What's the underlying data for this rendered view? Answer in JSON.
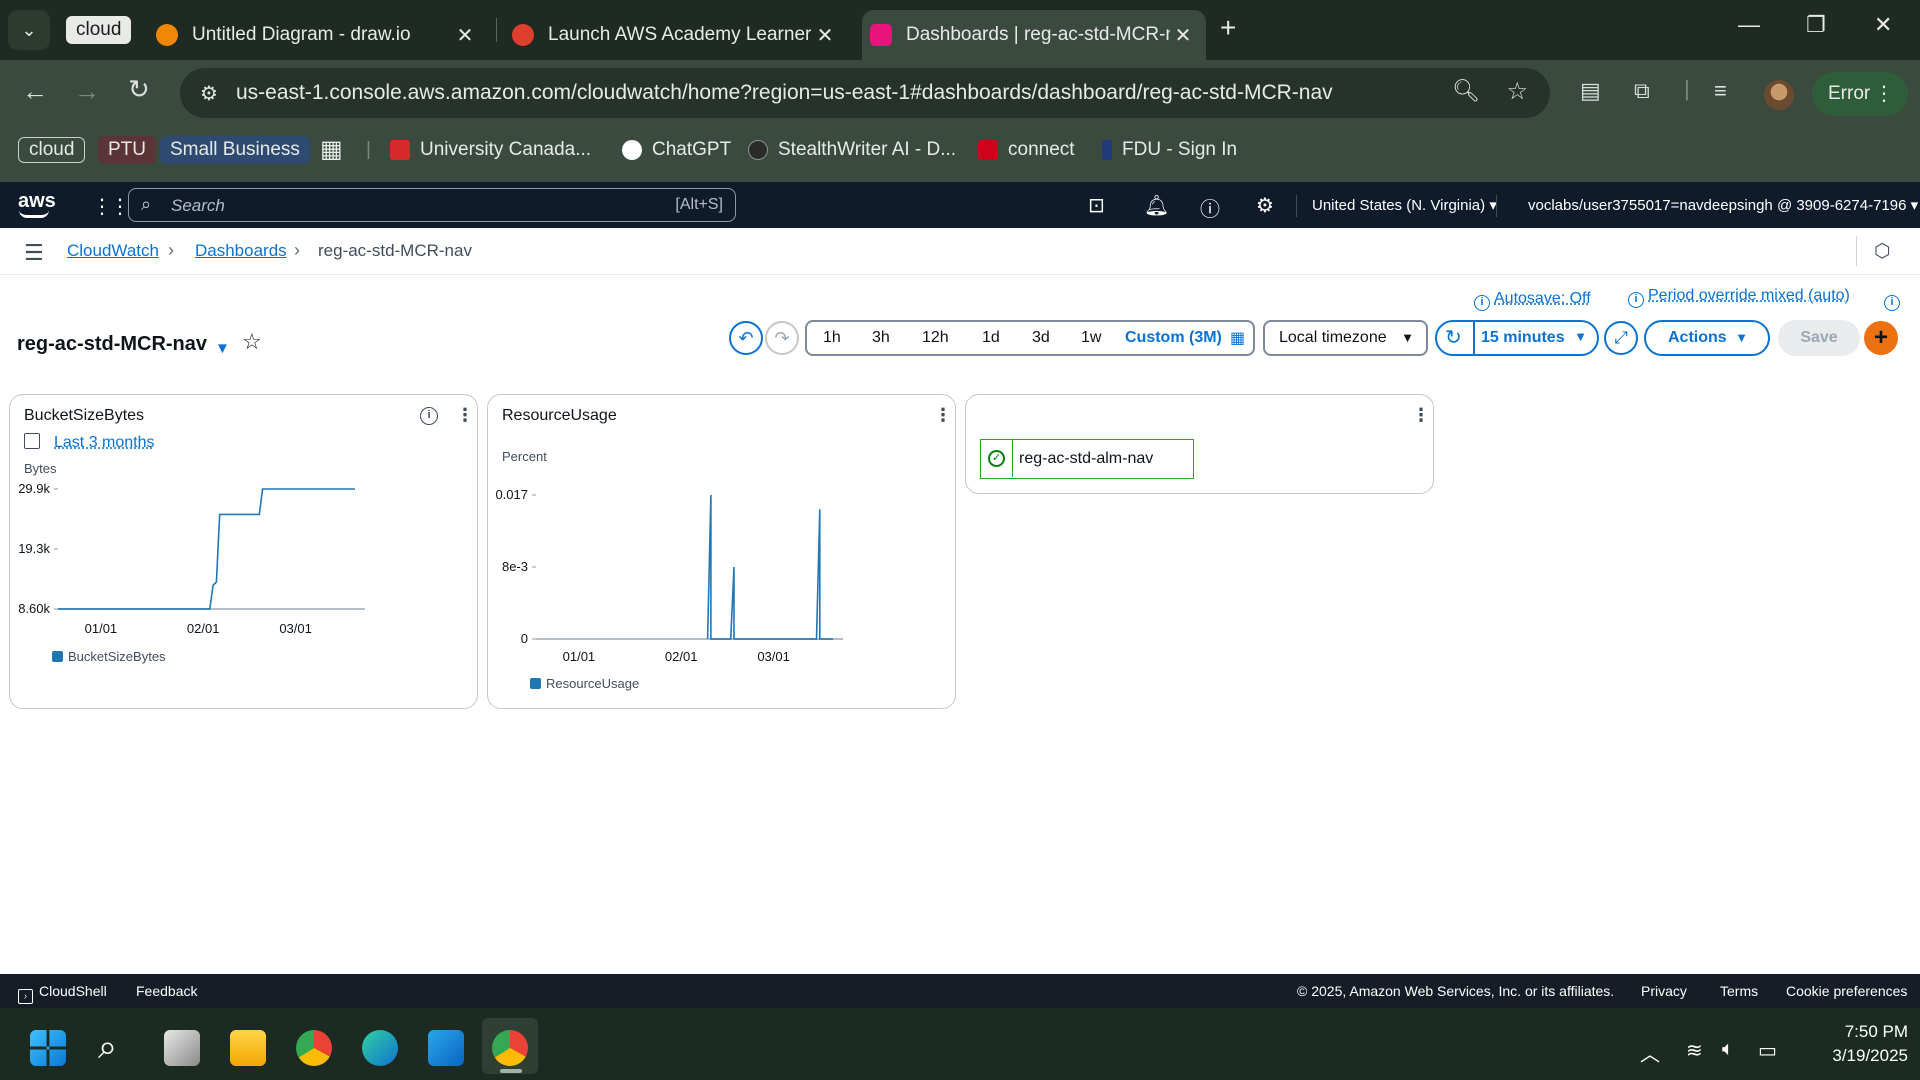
{
  "browser": {
    "tab_group": "cloud",
    "tabs": [
      {
        "title": "Untitled Diagram - draw.io",
        "icon": "drawio-icon",
        "color": "#f08705"
      },
      {
        "title": "Launch AWS Academy Learner La",
        "icon": "canvas-icon",
        "color": "#e03e2d"
      },
      {
        "title": "Dashboards | reg-ac-std-MCR-nav",
        "icon": "cloudwatch-icon",
        "color": "#e7157b"
      }
    ],
    "close_glyph": "✕",
    "new_tab_glyph": "+",
    "url": "us-east-1.console.aws.amazon.com/cloudwatch/home?region=us-east-1#dashboards/dashboard/reg-ac-std-MCR-nav",
    "profile_status": "Error",
    "bookmarks": [
      {
        "label": "cloud",
        "style": "pill-outline"
      },
      {
        "label": "PTU",
        "style": "pill-red"
      },
      {
        "label": "Small Business",
        "style": "pill-blue"
      },
      {
        "label": "University Canada...",
        "icon": "university-icon",
        "color": "#d62a2a"
      },
      {
        "label": "ChatGPT",
        "icon": "chatgpt-icon",
        "color": "#ffffff"
      },
      {
        "label": "StealthWriter AI - D...",
        "icon": "stealthwriter-icon",
        "color": "#2b2b2b"
      },
      {
        "label": "connect",
        "icon": "mcgrawhill-icon",
        "color": "#d0021b"
      },
      {
        "label": "FDU - Sign In",
        "icon": "fdu-icon",
        "color": "#223a7a"
      }
    ]
  },
  "aws": {
    "logo": "aws",
    "search_placeholder": "Search",
    "search_shortcut": "[Alt+S]",
    "region": "United States (N. Virginia)",
    "account": "voclabs/user3755017=navdeepsingh @ 3909-6274-7196"
  },
  "breadcrumb": [
    "CloudWatch",
    "Dashboards",
    "reg-ac-std-MCR-nav"
  ],
  "dashboard": {
    "title": "reg-ac-std-MCR-nav",
    "autosave": "Autosave: Off",
    "period_override": "Period override mixed (auto)",
    "ranges": [
      "1h",
      "3h",
      "12h",
      "1d",
      "3d",
      "1w"
    ],
    "custom_range": "Custom (3M)",
    "timezone": "Local timezone",
    "refresh_interval": "15 minutes",
    "actions": "Actions",
    "save": "Save",
    "add": "+"
  },
  "widgets": {
    "bucket": {
      "title": "BucketSizeBytes",
      "period": "Last 3 months"
    },
    "resource": {
      "title": "ResourceUsage"
    },
    "alarm": {
      "label": "reg-ac-std-alm-nav",
      "state_color": "#037f0c"
    }
  },
  "chart_data": [
    {
      "type": "line",
      "title": "BucketSizeBytes",
      "ylabel": "Bytes",
      "x_ticks": [
        "01/01",
        "02/01",
        "03/01"
      ],
      "y_ticks": [
        "8.60k",
        "19.3k",
        "29.9k"
      ],
      "ylim": [
        8600,
        29900
      ],
      "xlim": [
        "2024-12-19",
        "2025-03-19"
      ],
      "series": [
        {
          "name": "BucketSizeBytes",
          "color": "#1f77b4",
          "x": [
            "2024-12-19",
            "2025-02-03",
            "2025-02-04",
            "2025-02-05",
            "2025-02-06",
            "2025-02-18",
            "2025-02-19",
            "2025-03-19"
          ],
          "y": [
            8600,
            8600,
            12800,
            13400,
            25400,
            25400,
            29900,
            29900
          ]
        }
      ]
    },
    {
      "type": "line",
      "title": "ResourceUsage",
      "ylabel": "Percent",
      "x_ticks": [
        "01/01",
        "02/01",
        "03/01"
      ],
      "y_ticks": [
        "0",
        "8e-3",
        "0.017"
      ],
      "ylim": [
        0,
        0.017
      ],
      "xlim": [
        "2024-12-19",
        "2025-03-19"
      ],
      "series": [
        {
          "name": "ResourceUsage",
          "color": "#1f77b4",
          "x": [
            "2024-12-19",
            "2025-02-09",
            "2025-02-10",
            "2025-02-10",
            "2025-02-16",
            "2025-02-17",
            "2025-02-17",
            "2025-03-14",
            "2025-03-15",
            "2025-03-15",
            "2025-03-19"
          ],
          "y": [
            null,
            0,
            0.017,
            0,
            0,
            0.0085,
            0,
            0,
            0.0153,
            0,
            0
          ]
        }
      ]
    }
  ],
  "footer": {
    "cloudshell": "CloudShell",
    "feedback": "Feedback",
    "copyright": "© 2025, Amazon Web Services, Inc. or its affiliates.",
    "privacy": "Privacy",
    "terms": "Terms",
    "cookie": "Cookie preferences"
  },
  "taskbar": {
    "time": "7:50 PM",
    "date": "3/19/2025"
  }
}
